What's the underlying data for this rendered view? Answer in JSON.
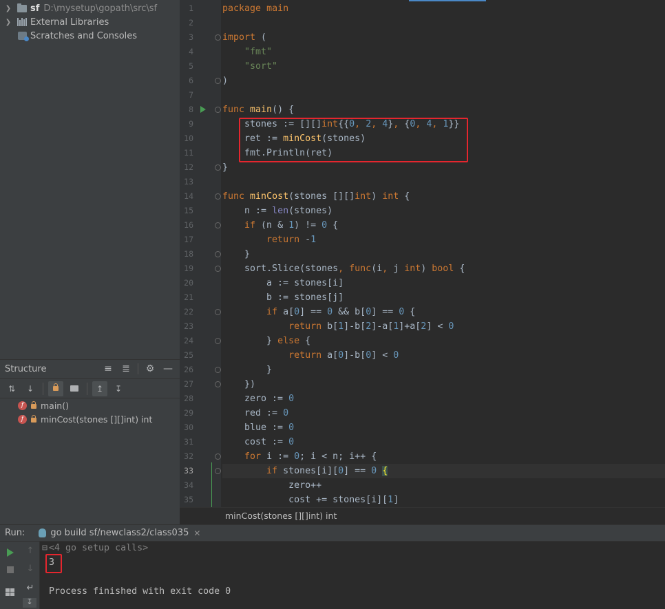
{
  "project_tree": {
    "items": [
      {
        "name": "sf",
        "path": "D:\\mysetup\\gopath\\src\\sf"
      },
      {
        "name": "External Libraries"
      },
      {
        "name": "Scratches and Consoles"
      }
    ]
  },
  "structure": {
    "title": "Structure",
    "items": [
      {
        "label": "main()"
      },
      {
        "label": "minCost(stones [][]int) int"
      }
    ]
  },
  "editor": {
    "current_line": 33,
    "line_numbers": [
      "1",
      "2",
      "3",
      "4",
      "5",
      "6",
      "7",
      "8",
      "9",
      "10",
      "11",
      "12",
      "13",
      "14",
      "15",
      "16",
      "17",
      "18",
      "19",
      "20",
      "21",
      "22",
      "23",
      "24",
      "25",
      "26",
      "27",
      "28",
      "29",
      "30",
      "31",
      "32",
      "33",
      "34",
      "35"
    ],
    "lines": [
      "package main",
      "",
      "import (",
      "    \"fmt\"",
      "    \"sort\"",
      ")",
      "",
      "func main() {",
      "    stones := [][]int{{0, 2, 4}, {0, 4, 1}}",
      "    ret := minCost(stones)",
      "    fmt.Println(ret)",
      "}",
      "",
      "func minCost(stones [][]int) int {",
      "    n := len(stones)",
      "    if (n & 1) != 0 {",
      "        return -1",
      "    }",
      "    sort.Slice(stones, func(i, j int) bool {",
      "        a := stones[i]",
      "        b := stones[j]",
      "        if a[0] == 0 && b[0] == 0 {",
      "            return b[1]-b[2]-a[1]+a[2] < 0",
      "        } else {",
      "            return a[0]-b[0] < 0",
      "        }",
      "    })",
      "    zero := 0",
      "    red := 0",
      "    blue := 0",
      "    cost := 0",
      "    for i := 0; i < n; i++ {",
      "        if stones[i][0] == 0 {",
      "            zero++",
      "            cost += stones[i][1]"
    ],
    "breadcrumb": "minCost(stones [][]int) int"
  },
  "run": {
    "label": "Run:",
    "tab_title": "go build sf/newclass2/class035",
    "console": [
      "<4 go setup calls>",
      "3",
      "",
      "Process finished with exit code 0"
    ]
  },
  "colors": {
    "highlight_box": "#e5262e",
    "keyword": "#cc7832",
    "string": "#6a8759",
    "number": "#6897bb",
    "function": "#ffc66d"
  }
}
